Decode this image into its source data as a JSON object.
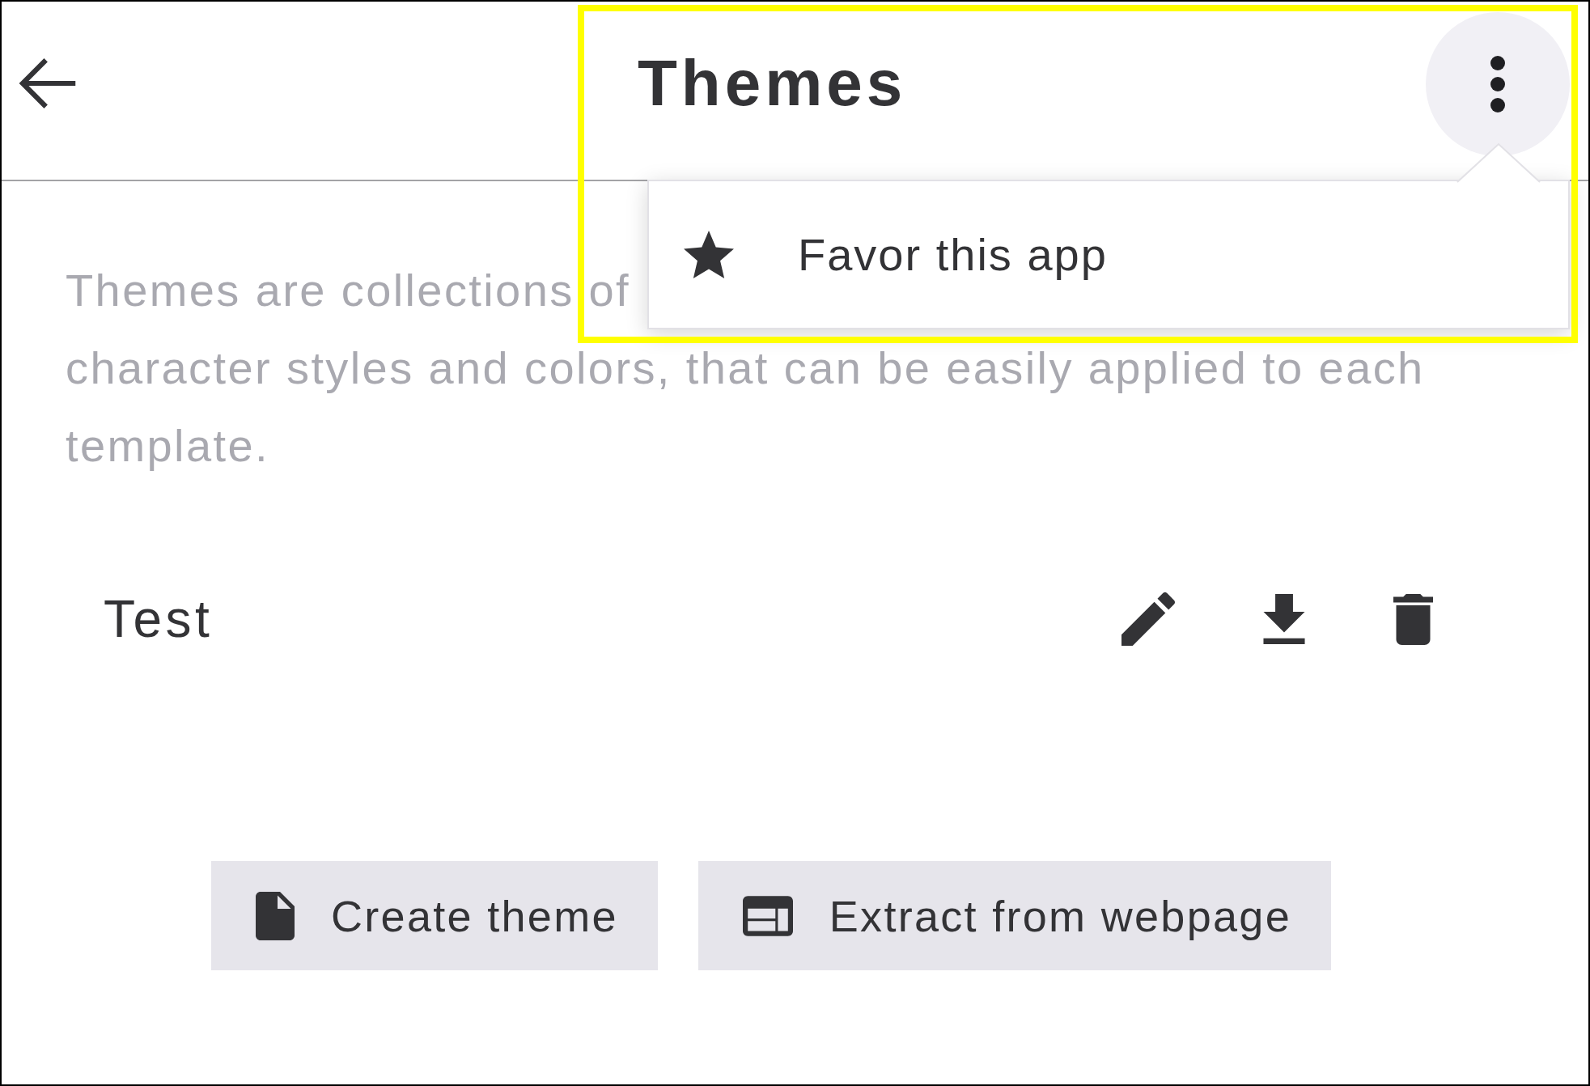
{
  "header": {
    "title": "Themes"
  },
  "overflow_menu": {
    "open": true,
    "highlighted": true,
    "items": [
      {
        "label": "Favor this app"
      }
    ]
  },
  "description": {
    "lines": [
      "Themes are collections of",
      "character styles and colors, that can be easily applied to each",
      "template."
    ]
  },
  "themes": [
    {
      "name": "Test"
    }
  ],
  "actions": [
    {
      "kind": "create",
      "label": "Create theme"
    },
    {
      "kind": "extract",
      "label": "Extract from webpage"
    }
  ]
}
